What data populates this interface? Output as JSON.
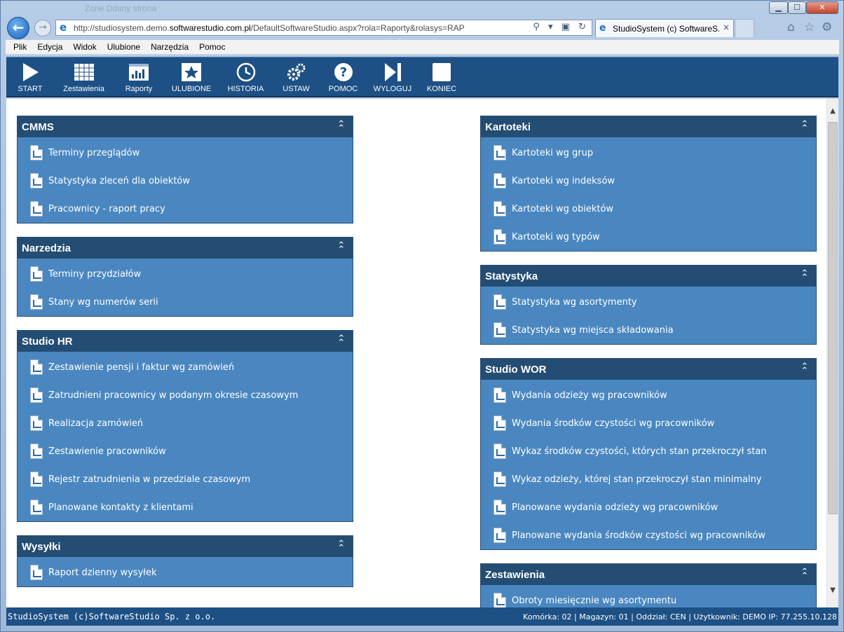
{
  "browser": {
    "url_prefix": "http://studiosystem.demo.",
    "url_domain": "softwarestudio.com.pl",
    "url_path": "/DefaultSoftwareStudio.aspx?rola=Raporty&rolasys=RAP",
    "address_tools": "⚲ ▾ ▣ ↻",
    "tab_title": "StudioSystem (c) SoftwareS...",
    "tab_close": "×",
    "window_buttons": {
      "minimize": "▁",
      "maximize": "☐",
      "close": "✕"
    },
    "ghost_title": "Zone    Ddany strona",
    "icons": {
      "back": "←",
      "forward": "→",
      "home": "⌂",
      "favorites": "☆",
      "tools": "⚙"
    }
  },
  "menubar": [
    {
      "label": "Plik"
    },
    {
      "label": "Edycja"
    },
    {
      "label": "Widok"
    },
    {
      "label": "Ulubione"
    },
    {
      "label": "Narzędzia"
    },
    {
      "label": "Pomoc"
    }
  ],
  "toolbar": [
    {
      "label": "START",
      "icon": "play-icon"
    },
    {
      "label": "Zestawienia",
      "icon": "table-icon"
    },
    {
      "label": "Raporty",
      "icon": "report-icon"
    },
    {
      "label": "ULUBIONE",
      "icon": "star-icon"
    },
    {
      "label": "HISTORIA",
      "icon": "history-icon"
    },
    {
      "label": "USTAW",
      "icon": "gears-icon"
    },
    {
      "label": "POMOC",
      "icon": "help-icon"
    },
    {
      "label": "WYLOGUJ",
      "icon": "logout-icon"
    },
    {
      "label": "KONIEC",
      "icon": "stop-icon"
    }
  ],
  "panels_left": [
    {
      "title": "CMMS",
      "toggle": "⌃\n⌃",
      "items": [
        "Terminy przeglądów",
        "Statystyka zleceń dla obiektów",
        "Pracownicy - raport pracy"
      ]
    },
    {
      "title": "Narzedzia",
      "toggle": "⌃\n⌃",
      "items": [
        "Terminy przydziałów",
        "Stany wg numerów serii"
      ]
    },
    {
      "title": "Studio HR",
      "toggle": "⌃\n⌃",
      "items": [
        "Zestawienie pensji i faktur wg zamówień",
        "Zatrudnieni pracownicy w podanym okresie czasowym",
        "Realizacja zamówień",
        "Zestawienie pracowników",
        "Rejestr zatrudnienia w przedziale czasowym",
        "Planowane kontakty z klientami"
      ]
    },
    {
      "title": "Wysyłki",
      "toggle": "⌃\n⌃",
      "items": [
        "Raport dzienny wysyłek"
      ]
    }
  ],
  "panels_right": [
    {
      "title": "Kartoteki",
      "toggle": "⌃\n⌃",
      "items": [
        "Kartoteki wg grup",
        "Kartoteki wg indeksów",
        "Kartoteki wg obiektów",
        "Kartoteki wg typów"
      ]
    },
    {
      "title": "Statystyka",
      "toggle": "⌃\n⌃",
      "items": [
        "Statystyka wg asortymenty",
        "Statystyka wg miejsca składowania"
      ]
    },
    {
      "title": "Studio WOR",
      "toggle": "⌃\n⌃",
      "items": [
        "Wydania odzieży wg pracowników",
        "Wydania środków czystości wg pracowników",
        "Wykaz środków czystości, których stan przekroczył stan",
        "Wykaz odzieży, której stan przekroczył stan minimalny",
        "Planowane wydania odzieży wg pracowników",
        "Planowane wydania środków czystości wg pracowników"
      ]
    },
    {
      "title": "Zestawienia",
      "toggle": "⌃\n⌃",
      "items": [
        "Obroty miesięcznie wg asortymentu"
      ]
    }
  ],
  "scrollbar": {
    "up": "▲",
    "down": "▼"
  },
  "status": {
    "left": "StudioSystem (c)SoftwareStudio Sp. z o.o.",
    "right": "Komórka: 02 | Magazyn: 01 | Oddział: CEN | Użytkownik: DEMO IP: 77.255.10.128"
  },
  "colors": {
    "toolbar": "#1d5084",
    "panel_head": "#244d74",
    "panel_body": "#4a87c0"
  }
}
